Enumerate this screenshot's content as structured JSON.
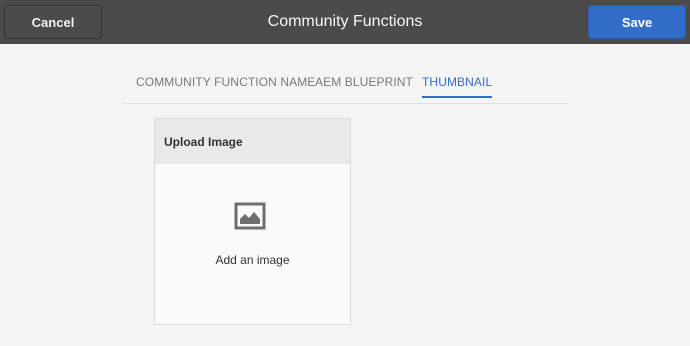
{
  "header": {
    "title": "Community Functions",
    "cancel_label": "Cancel",
    "save_label": "Save"
  },
  "tabs": [
    {
      "label": "COMMUNITY FUNCTION NAME",
      "active": false
    },
    {
      "label": "AEM BLUEPRINT",
      "active": false
    },
    {
      "label": "THUMBNAIL",
      "active": true
    }
  ],
  "upload": {
    "header": "Upload Image",
    "icon": "image-icon",
    "hint": "Add an image"
  },
  "colors": {
    "topbar": "#4b4b4b",
    "accent": "#326ec8",
    "background": "#f4f4f4"
  }
}
